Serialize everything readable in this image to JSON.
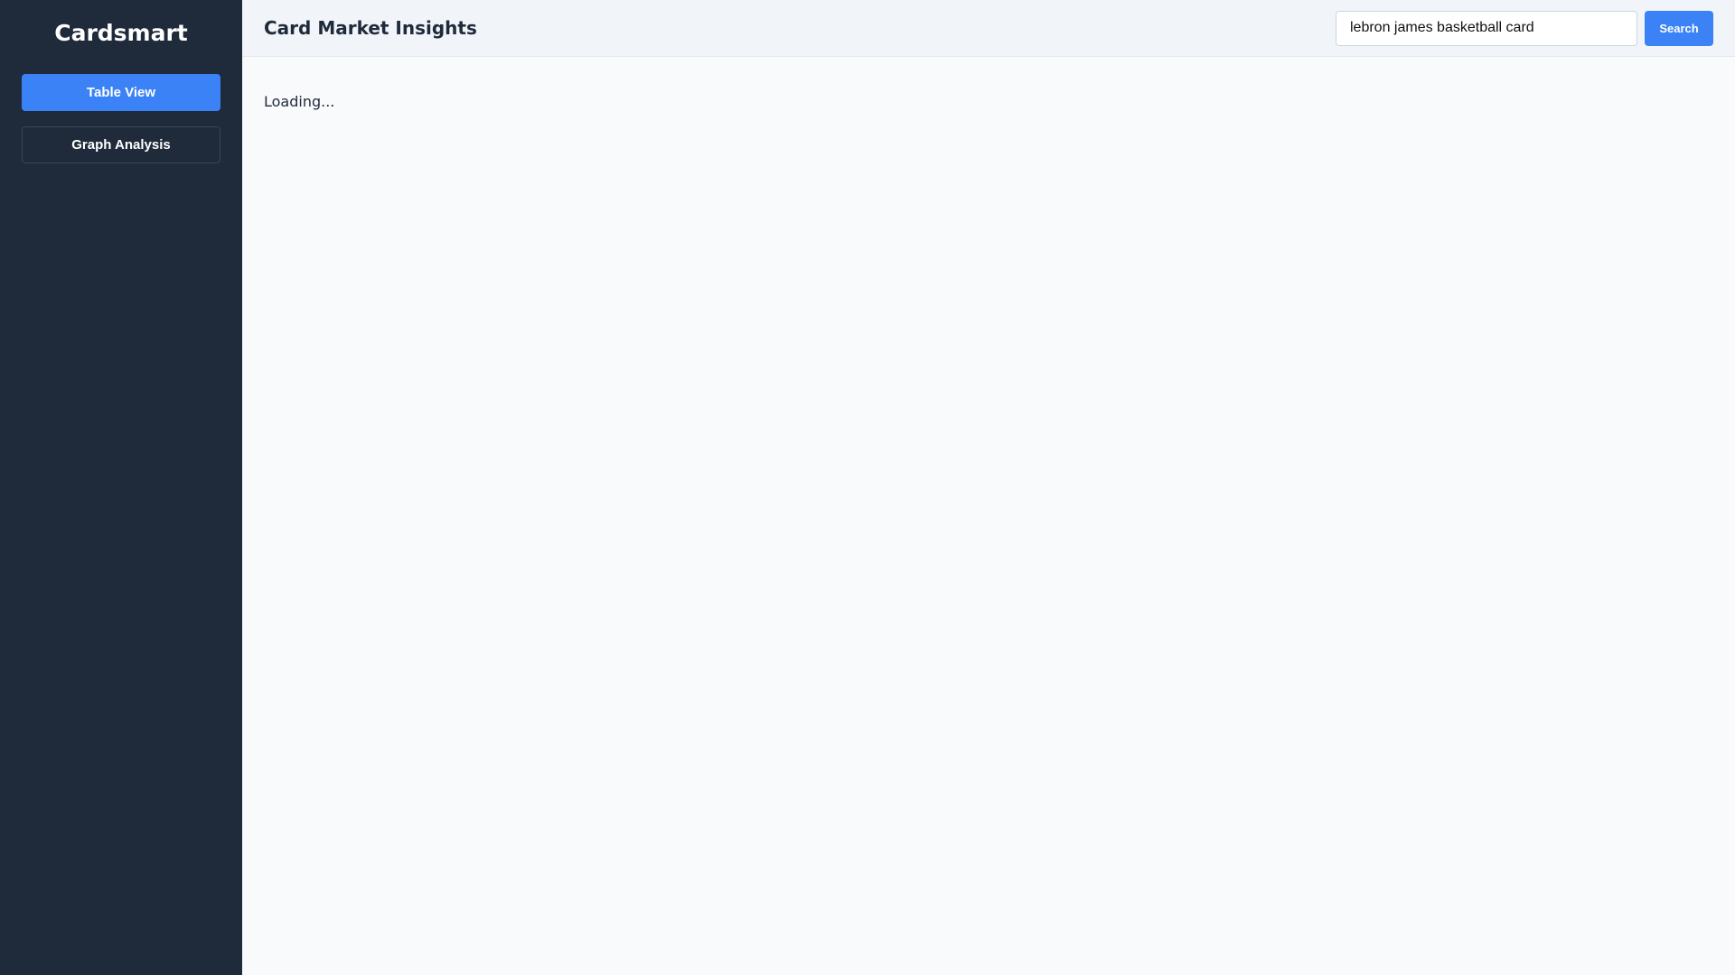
{
  "sidebar": {
    "brand": "Cardsmart",
    "items": [
      {
        "label": "Table View",
        "active": true
      },
      {
        "label": "Graph Analysis",
        "active": false
      }
    ]
  },
  "header": {
    "title": "Card Market Insights",
    "search": {
      "value": "lebron james basketball card",
      "button_label": "Search"
    }
  },
  "main": {
    "status": "Loading..."
  },
  "colors": {
    "sidebar_bg": "#1f2a3b",
    "accent": "#3b82f6",
    "header_bg": "#f1f5f9",
    "content_bg": "#f8fafc"
  }
}
